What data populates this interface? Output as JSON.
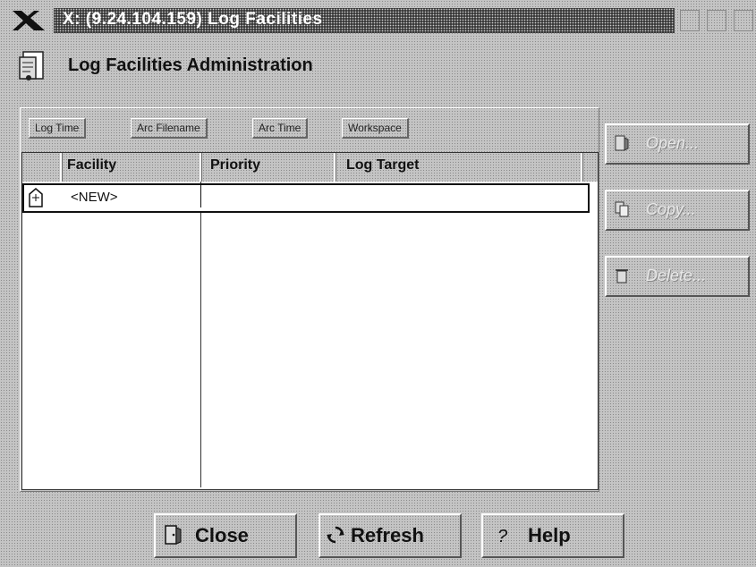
{
  "window": {
    "title": "X: (9.24.104.159) Log Facilities"
  },
  "app": {
    "title": "Log Facilities Administration"
  },
  "tabs": [
    {
      "label": "Log Time"
    },
    {
      "label": "Arc Filename"
    },
    {
      "label": "Arc Time"
    },
    {
      "label": "Workspace"
    }
  ],
  "table": {
    "columns": [
      "Facility",
      "Priority",
      "Log Target"
    ],
    "rows": [
      {
        "facility": "<NEW>",
        "priority": "",
        "log_target": ""
      }
    ]
  },
  "side_buttons": [
    {
      "label": "Open...",
      "icon": "open-icon",
      "enabled": false
    },
    {
      "label": "Copy...",
      "icon": "copy-icon",
      "enabled": false
    },
    {
      "label": "Delete...",
      "icon": "delete-icon",
      "enabled": false
    }
  ],
  "bottom_buttons": [
    {
      "label": "Close",
      "icon": "close-door-icon"
    },
    {
      "label": "Refresh",
      "icon": "refresh-icon"
    },
    {
      "label": "Help",
      "icon": "help-icon"
    }
  ]
}
